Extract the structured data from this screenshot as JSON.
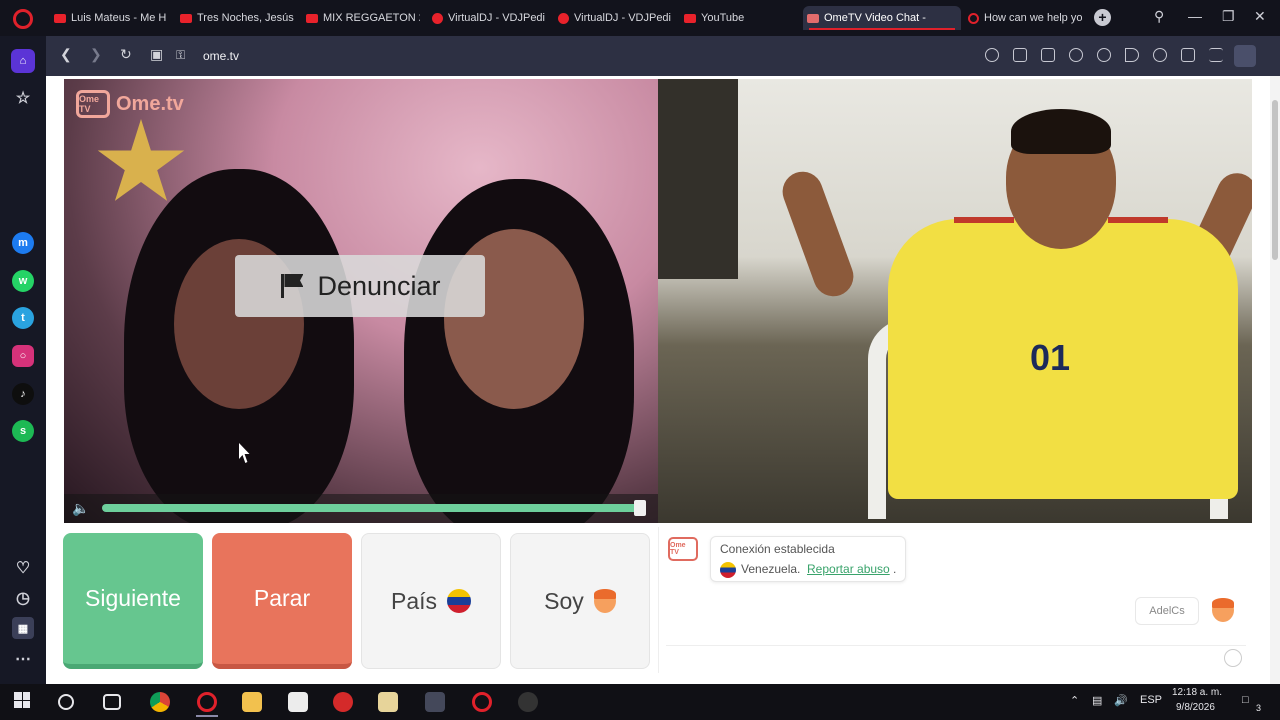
{
  "browser": {
    "tabs": [
      {
        "label": "Luis Mateus - Me H",
        "icon": "youtube-icon"
      },
      {
        "label": "Tres Noches, Jesús",
        "icon": "youtube-icon"
      },
      {
        "label": "MIX REGGAETON 2",
        "icon": "youtube-icon"
      },
      {
        "label": "VirtualDJ - VDJPedi",
        "icon": "vdj-icon"
      },
      {
        "label": "VirtualDJ - VDJPedi",
        "icon": "vdj-icon"
      },
      {
        "label": "YouTube",
        "icon": "youtube-icon"
      },
      {
        "label": "OmeTV Video Chat -",
        "icon": "ometv-icon",
        "active": true
      },
      {
        "label": "How can we help yo",
        "icon": "opera-icon"
      }
    ],
    "url": "ome.tv",
    "accent": "#e0212b"
  },
  "page": {
    "watermark": "Ome.tv",
    "watermark_logo": "Ome TV",
    "report_button": "Denunciar",
    "controls": {
      "next": "Siguiente",
      "stop": "Parar",
      "country": "País",
      "gender": "Soy"
    },
    "chat": {
      "logo": "Ome TV",
      "system_line1": "Conexión establecida",
      "country": "Venezuela.",
      "report_link": "Reportar abuso",
      "report_suffix": ".",
      "user_tag": "AdelCs"
    },
    "colors": {
      "next": "#66c68f",
      "stop": "#e8745c",
      "link": "#39a36b"
    }
  },
  "taskbar": {
    "tray_lang": "ESP",
    "time": "12:18 a. m.",
    "date": "9/8/2026",
    "notifications": "3"
  }
}
